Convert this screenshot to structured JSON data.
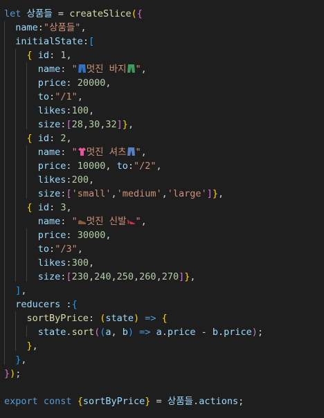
{
  "code": {
    "lines": [
      {
        "tokens": [
          [
            "let",
            "kw"
          ],
          [
            " ",
            "txt"
          ],
          [
            "상품들",
            "var"
          ],
          [
            " = ",
            "txt"
          ],
          [
            "createSlice",
            "fn"
          ],
          [
            "(",
            "b1"
          ],
          [
            "{",
            "b2"
          ]
        ]
      },
      {
        "tokens": [
          [
            "  ",
            "txt"
          ],
          [
            "name",
            "var"
          ],
          [
            ":",
            "txt"
          ],
          [
            "\"상품들\"",
            "str"
          ],
          [
            ",",
            "txt"
          ]
        ]
      },
      {
        "tokens": [
          [
            "  ",
            "txt"
          ],
          [
            "initialState",
            "var"
          ],
          [
            ":",
            "txt"
          ],
          [
            "[",
            "b3"
          ]
        ]
      },
      {
        "tokens": [
          [
            "    ",
            "txt"
          ],
          [
            "{",
            "b1"
          ],
          [
            " ",
            "txt"
          ],
          [
            "id",
            "var"
          ],
          [
            ": ",
            "txt"
          ],
          [
            "1",
            "num"
          ],
          [
            ",",
            "txt"
          ]
        ]
      },
      {
        "tokens": [
          [
            "      ",
            "txt"
          ],
          [
            "name",
            "var"
          ],
          [
            ": ",
            "txt"
          ],
          [
            "\"",
            "str"
          ],
          [
            "{pants}",
            "emoji"
          ],
          [
            "멋진 바지",
            "str"
          ],
          [
            "{pants2}",
            "emoji"
          ],
          [
            "\"",
            "str"
          ],
          [
            ",",
            "txt"
          ]
        ]
      },
      {
        "tokens": [
          [
            "      ",
            "txt"
          ],
          [
            "price",
            "var"
          ],
          [
            ": ",
            "txt"
          ],
          [
            "20000",
            "num"
          ],
          [
            ",",
            "txt"
          ]
        ]
      },
      {
        "tokens": [
          [
            "      ",
            "txt"
          ],
          [
            "to",
            "var"
          ],
          [
            ":",
            "txt"
          ],
          [
            "\"/1\"",
            "str"
          ],
          [
            ",",
            "txt"
          ]
        ]
      },
      {
        "tokens": [
          [
            "      ",
            "txt"
          ],
          [
            "likes",
            "var"
          ],
          [
            ":",
            "txt"
          ],
          [
            "100",
            "num"
          ],
          [
            ",",
            "txt"
          ]
        ]
      },
      {
        "tokens": [
          [
            "      ",
            "txt"
          ],
          [
            "size",
            "var"
          ],
          [
            ":",
            "txt"
          ],
          [
            "[",
            "b2"
          ],
          [
            "28",
            "num"
          ],
          [
            ",",
            "txt"
          ],
          [
            "30",
            "num"
          ],
          [
            ",",
            "txt"
          ],
          [
            "32",
            "num"
          ],
          [
            "]",
            "b2"
          ],
          [
            "}",
            "b1"
          ],
          [
            ",",
            "txt"
          ]
        ]
      },
      {
        "tokens": [
          [
            "    ",
            "txt"
          ],
          [
            "{",
            "b1"
          ],
          [
            " ",
            "txt"
          ],
          [
            "id",
            "var"
          ],
          [
            ": ",
            "txt"
          ],
          [
            "2",
            "num"
          ],
          [
            ",",
            "txt"
          ]
        ]
      },
      {
        "tokens": [
          [
            "      ",
            "txt"
          ],
          [
            "name",
            "var"
          ],
          [
            ": ",
            "txt"
          ],
          [
            "\"",
            "str"
          ],
          [
            "{shirt}",
            "emoji"
          ],
          [
            "멋진 셔츠",
            "str"
          ],
          [
            "{jeans}",
            "emoji"
          ],
          [
            "\"",
            "str"
          ],
          [
            ",",
            "txt"
          ]
        ]
      },
      {
        "tokens": [
          [
            "      ",
            "txt"
          ],
          [
            "price",
            "var"
          ],
          [
            ": ",
            "txt"
          ],
          [
            "10000",
            "num"
          ],
          [
            ", ",
            "txt"
          ],
          [
            "to",
            "var"
          ],
          [
            ":",
            "txt"
          ],
          [
            "\"/2\"",
            "str"
          ],
          [
            ",",
            "txt"
          ]
        ]
      },
      {
        "tokens": [
          [
            "      ",
            "txt"
          ],
          [
            "likes",
            "var"
          ],
          [
            ":",
            "txt"
          ],
          [
            "200",
            "num"
          ],
          [
            ",",
            "txt"
          ]
        ]
      },
      {
        "tokens": [
          [
            "      ",
            "txt"
          ],
          [
            "size",
            "var"
          ],
          [
            ":",
            "txt"
          ],
          [
            "[",
            "b2"
          ],
          [
            "'small'",
            "str"
          ],
          [
            ",",
            "txt"
          ],
          [
            "'medium'",
            "str"
          ],
          [
            ",",
            "txt"
          ],
          [
            "'large'",
            "str"
          ],
          [
            "]",
            "b2"
          ],
          [
            "}",
            "b1"
          ],
          [
            ",",
            "txt"
          ]
        ]
      },
      {
        "tokens": [
          [
            "    ",
            "txt"
          ],
          [
            "{",
            "b1"
          ],
          [
            " ",
            "txt"
          ],
          [
            "id",
            "var"
          ],
          [
            ": ",
            "txt"
          ],
          [
            "3",
            "num"
          ],
          [
            ",",
            "txt"
          ]
        ]
      },
      {
        "tokens": [
          [
            "      ",
            "txt"
          ],
          [
            "name",
            "var"
          ],
          [
            ": ",
            "txt"
          ],
          [
            "\"",
            "str"
          ],
          [
            "{shoe}",
            "emoji"
          ],
          [
            "멋진 신발",
            "str"
          ],
          [
            "{heel}",
            "emoji"
          ],
          [
            "\"",
            "str"
          ],
          [
            ",",
            "txt"
          ]
        ]
      },
      {
        "tokens": [
          [
            "      ",
            "txt"
          ],
          [
            "price",
            "var"
          ],
          [
            ": ",
            "txt"
          ],
          [
            "30000",
            "num"
          ],
          [
            ",",
            "txt"
          ]
        ]
      },
      {
        "tokens": [
          [
            "      ",
            "txt"
          ],
          [
            "to",
            "var"
          ],
          [
            ":",
            "txt"
          ],
          [
            "\"/3\"",
            "str"
          ],
          [
            ",",
            "txt"
          ]
        ]
      },
      {
        "tokens": [
          [
            "      ",
            "txt"
          ],
          [
            "likes",
            "var"
          ],
          [
            ":",
            "txt"
          ],
          [
            "300",
            "num"
          ],
          [
            ",",
            "txt"
          ]
        ]
      },
      {
        "tokens": [
          [
            "      ",
            "txt"
          ],
          [
            "size",
            "var"
          ],
          [
            ":",
            "txt"
          ],
          [
            "[",
            "b2"
          ],
          [
            "230",
            "num"
          ],
          [
            ",",
            "txt"
          ],
          [
            "240",
            "num"
          ],
          [
            ",",
            "txt"
          ],
          [
            "250",
            "num"
          ],
          [
            ",",
            "txt"
          ],
          [
            "260",
            "num"
          ],
          [
            ",",
            "txt"
          ],
          [
            "270",
            "num"
          ],
          [
            "]",
            "b2"
          ],
          [
            "}",
            "b1"
          ],
          [
            ",",
            "txt"
          ]
        ]
      },
      {
        "tokens": [
          [
            "  ",
            "txt"
          ],
          [
            "]",
            "b3"
          ],
          [
            ",",
            "txt"
          ]
        ]
      },
      {
        "tokens": [
          [
            "  ",
            "txt"
          ],
          [
            "reducers",
            "var"
          ],
          [
            " :",
            "txt"
          ],
          [
            "{",
            "b3"
          ]
        ]
      },
      {
        "tokens": [
          [
            "    ",
            "txt"
          ],
          [
            "sortByPrice",
            "fn"
          ],
          [
            ": ",
            "txt"
          ],
          [
            "(",
            "b1"
          ],
          [
            "state",
            "var"
          ],
          [
            ")",
            "b1"
          ],
          [
            " => ",
            "kw"
          ],
          [
            "{",
            "b1"
          ]
        ]
      },
      {
        "tokens": [
          [
            "      ",
            "txt"
          ],
          [
            "state",
            "var"
          ],
          [
            ".",
            "txt"
          ],
          [
            "sort",
            "fn"
          ],
          [
            "(",
            "b2"
          ],
          [
            "(",
            "b3"
          ],
          [
            "a",
            "var"
          ],
          [
            ", ",
            "txt"
          ],
          [
            "b",
            "var"
          ],
          [
            ")",
            "b3"
          ],
          [
            " => ",
            "kw"
          ],
          [
            "a",
            "var"
          ],
          [
            ".",
            "txt"
          ],
          [
            "price",
            "var"
          ],
          [
            " - ",
            "txt"
          ],
          [
            "b",
            "var"
          ],
          [
            ".",
            "txt"
          ],
          [
            "price",
            "var"
          ],
          [
            ")",
            "b2"
          ],
          [
            ";",
            "txt"
          ]
        ]
      },
      {
        "tokens": [
          [
            "    ",
            "txt"
          ],
          [
            "}",
            "b1"
          ],
          [
            ",",
            "txt"
          ]
        ]
      },
      {
        "tokens": [
          [
            "  ",
            "txt"
          ],
          [
            "}",
            "b3"
          ],
          [
            ",",
            "txt"
          ]
        ]
      },
      {
        "tokens": [
          [
            "}",
            "b2"
          ],
          [
            ")",
            "b1"
          ],
          [
            ";",
            "txt"
          ]
        ]
      },
      {
        "tokens": []
      },
      {
        "tokens": [
          [
            "export",
            "kw"
          ],
          [
            " ",
            "txt"
          ],
          [
            "const",
            "kw"
          ],
          [
            " ",
            "txt"
          ],
          [
            "{",
            "b1"
          ],
          [
            "sortByPrice",
            "var"
          ],
          [
            "}",
            "b1"
          ],
          [
            " = ",
            "txt"
          ],
          [
            "상품들",
            "var"
          ],
          [
            ".",
            "txt"
          ],
          [
            "actions",
            "var"
          ],
          [
            ";",
            "txt"
          ]
        ]
      }
    ],
    "emoji_colors": {
      "pants": "#2f73c9",
      "pants2": "#3d9a5b",
      "shirt": "#e8559c",
      "jeans": "#5a7fc0",
      "shoe": "#8a5a3a",
      "heel": "#c8324a"
    }
  }
}
